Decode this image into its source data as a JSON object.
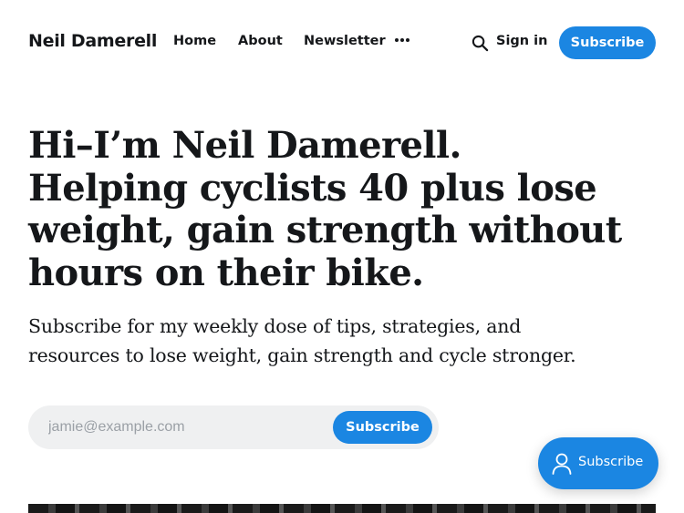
{
  "header": {
    "brand": "Neil Damerell",
    "nav": [
      {
        "label": "Home"
      },
      {
        "label": "About"
      },
      {
        "label": "Newsletter"
      }
    ],
    "more_icon": "more-horizontal-icon",
    "search_icon": "search-icon",
    "sign_in_label": "Sign in",
    "subscribe_label": "Subscribe"
  },
  "hero": {
    "headline": "Hi–I’m Neil Damerell. Helping cyclists 40 plus lose weight, gain strength without hours on their bike.",
    "subheadline": "Subscribe for my weekly dose of tips, strategies, and resources to lose weight, gain strength and cycle stronger."
  },
  "signup": {
    "email_value": "",
    "email_placeholder": "jamie@example.com",
    "button_label": "Subscribe"
  },
  "portal": {
    "icon": "user-icon",
    "label": "Subscribe"
  },
  "colors": {
    "accent": "#1b86e2",
    "text": "#15171a",
    "form_background": "#eff0f1",
    "placeholder": "#9ba0a6"
  }
}
